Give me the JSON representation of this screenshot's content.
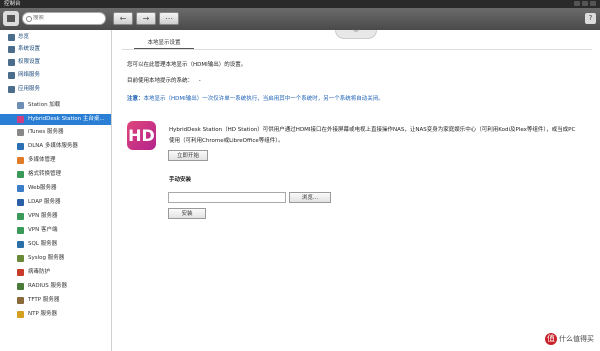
{
  "window": {
    "title": "控制台"
  },
  "toolbar": {
    "search_placeholder": "搜索",
    "back": "←",
    "forward": "→",
    "grid": "⋯",
    "help": "?"
  },
  "sidebar": {
    "categories": [
      {
        "label": "总览",
        "color": "#4a6d8c"
      },
      {
        "label": "系统设置",
        "color": "#4a6d8c"
      },
      {
        "label": "权限设置",
        "color": "#4a6d8c"
      },
      {
        "label": "网络服务",
        "color": "#4a6d8c"
      },
      {
        "label": "应用服务",
        "color": "#4a6d8c"
      }
    ],
    "items": [
      {
        "label": "Station 加载",
        "color": "#6c8fb3"
      },
      {
        "label": "HybridDesk Station 主台桌...",
        "color": "#d13e82"
      },
      {
        "label": "iTunes 服务器",
        "color": "#888888"
      },
      {
        "label": "DLNA 多媒体服务器",
        "color": "#2b6fb5"
      },
      {
        "label": "多媒体管理",
        "color": "#e07b2a"
      },
      {
        "label": "格式转换管理",
        "color": "#3a9a5a"
      },
      {
        "label": "Web服务器",
        "color": "#3a7dc9"
      },
      {
        "label": "LDAP 服务器",
        "color": "#2a5fa8"
      },
      {
        "label": "VPN 服务器",
        "color": "#3a9a5a"
      },
      {
        "label": "VPN 客户端",
        "color": "#3a9a5a"
      },
      {
        "label": "SQL 服务器",
        "color": "#2a6fa8"
      },
      {
        "label": "Syslog 服务器",
        "color": "#6a8a3a"
      },
      {
        "label": "病毒防护",
        "color": "#c83a2a"
      },
      {
        "label": "RADIUS 服务器",
        "color": "#4a7a3a"
      },
      {
        "label": "TFTP 服务器",
        "color": "#8a6a3a"
      },
      {
        "label": "NTP 服务器",
        "color": "#d4a020"
      }
    ]
  },
  "main": {
    "tab": "本地显示设置",
    "intro": "您可以在此管理本地显示（HDMI输出）的设置。",
    "current_label": "目前使用本地提示的系统：",
    "current_value": "-",
    "note_label": "注意：",
    "note_text": "本地显示（HDMI输出）一次仅许单一系统执行，当启用其中一个系统时，另一个系统将自动关闭。",
    "logo_text": "HD",
    "desc_line1": "HybridDesk Station（HD Station）可供用户通过HDMI接口在外接屏幕或电视上直接操作NAS，让NAS变身为家庭娱乐中心（可利用Kodi及Plex等组件），或当成PC",
    "desc_line2": "使用（可利用Chrome或LibreOffice等组件）。",
    "start_button": "立即开始",
    "manual_title": "手动安装",
    "browse_button": "浏览...",
    "install_button": "安装"
  },
  "watermark": {
    "icon": "值",
    "text": "什么值得买"
  }
}
